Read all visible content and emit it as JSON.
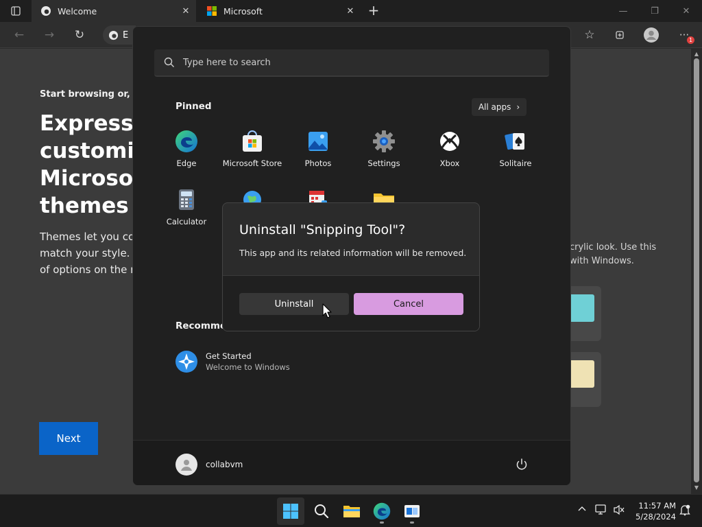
{
  "browser": {
    "tabs": [
      {
        "title": "Welcome",
        "active": true
      },
      {
        "title": "Microsoft",
        "active": false
      }
    ],
    "address_partial": "E",
    "notification_count": "1"
  },
  "page": {
    "intro": "Start browsing or,",
    "hero": "Express y\ncustomizi\nMicrosoft\nthemes",
    "description": "Themes let you colo\nmatch your style. C\nof options on the ri",
    "next_label": "Next",
    "right_text": "crylic look. Use this\nwith Windows."
  },
  "start_menu": {
    "search_placeholder": "Type here to search",
    "pinned_label": "Pinned",
    "all_apps_label": "All apps",
    "pinned_apps": [
      {
        "label": "Edge"
      },
      {
        "label": "Microsoft Store"
      },
      {
        "label": "Photos"
      },
      {
        "label": "Settings"
      },
      {
        "label": "Xbox"
      },
      {
        "label": "Solitaire"
      },
      {
        "label": "Calculator"
      }
    ],
    "recommended_label": "Recommen",
    "recommended_items": [
      {
        "title": "Get Started",
        "subtitle": "Welcome to Windows"
      }
    ],
    "user_name": "collabvm"
  },
  "dialog": {
    "title": "Uninstall \"Snipping Tool\"?",
    "message": "This app and its related information will be removed.",
    "uninstall_label": "Uninstall",
    "cancel_label": "Cancel"
  },
  "taskbar": {
    "time": "11:57 AM",
    "date": "5/28/2024"
  },
  "colors": {
    "accent": "#0a64c8",
    "cancel_button": "#d89be0",
    "start_bg": "#202020"
  }
}
